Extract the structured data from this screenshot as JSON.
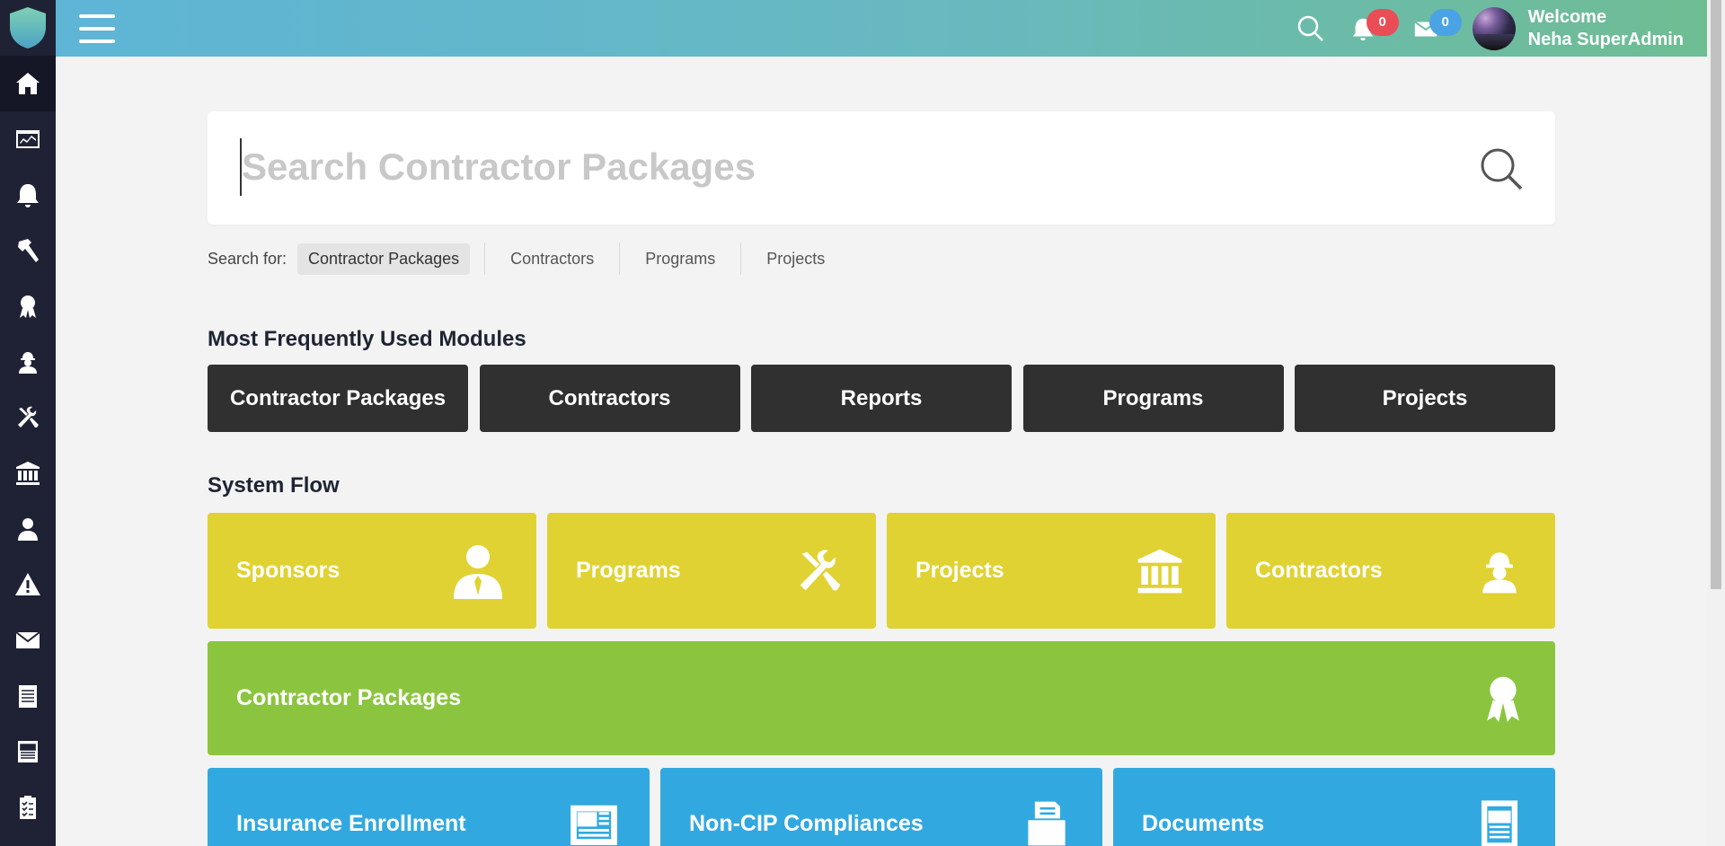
{
  "header": {
    "welcome_line1": "Welcome",
    "welcome_line2": "Neha SuperAdmin",
    "notifications_count": "0",
    "messages_count": "0"
  },
  "sidebar": {
    "items": [
      {
        "icon": "home-icon",
        "active": true
      },
      {
        "icon": "dashboard-chart-icon"
      },
      {
        "icon": "bell-icon"
      },
      {
        "icon": "hammer-icon"
      },
      {
        "icon": "award-ribbon-icon"
      },
      {
        "icon": "worker-icon"
      },
      {
        "icon": "tools-icon"
      },
      {
        "icon": "bank-icon"
      },
      {
        "icon": "user-tie-icon"
      },
      {
        "icon": "warning-icon"
      },
      {
        "icon": "envelope-icon"
      },
      {
        "icon": "notepad-icon"
      },
      {
        "icon": "newspaper-icon"
      },
      {
        "icon": "clipboard-checklist-icon"
      }
    ]
  },
  "search": {
    "placeholder": "Search Contractor Packages",
    "search_for_label": "Search for:",
    "options": [
      "Contractor Packages",
      "Contractors",
      "Programs",
      "Projects"
    ],
    "selected": "Contractor Packages"
  },
  "modules": {
    "title": "Most Frequently Used Modules",
    "items": [
      "Contractor Packages",
      "Contractors",
      "Reports",
      "Programs",
      "Projects"
    ]
  },
  "system_flow": {
    "title": "System Flow",
    "row1": [
      {
        "label": "Sponsors",
        "icon": "person-tie-icon"
      },
      {
        "label": "Programs",
        "icon": "tools-icon"
      },
      {
        "label": "Projects",
        "icon": "bank-icon"
      },
      {
        "label": "Contractors",
        "icon": "worker-icon"
      }
    ],
    "row2": {
      "label": "Contractor Packages",
      "icon": "award-ribbon-icon"
    },
    "row3": [
      {
        "label": "Insurance Enrollment",
        "icon": "newspaper-icon"
      },
      {
        "label": "Non-CIP Compliances",
        "icon": "fax-icon"
      },
      {
        "label": "Documents",
        "icon": "document-icon"
      }
    ]
  },
  "colors": {
    "sidebar": "#1f2235",
    "header_start": "#5eb5d6",
    "header_end": "#6fbd93",
    "module_button": "#303030",
    "tile_yellow": "#e0d232",
    "tile_green": "#8bc53f",
    "tile_blue": "#31a9e0",
    "badge_red": "#ea4d55",
    "badge_blue": "#4aa3e4"
  }
}
